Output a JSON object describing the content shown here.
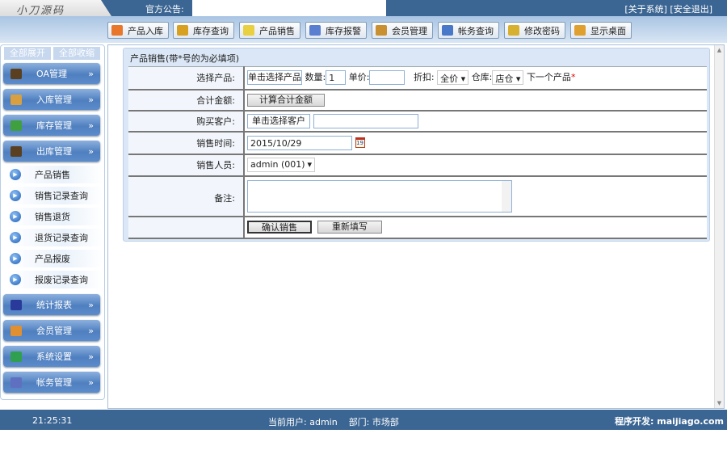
{
  "header": {
    "logo": "小刀源码",
    "notice_label": "官方公告:",
    "links": [
      "[关于系统]",
      "[安全退出]"
    ]
  },
  "toolbar": [
    {
      "label": "产品入库",
      "icon": "house-icon",
      "color": "#e8762b"
    },
    {
      "label": "库存查询",
      "icon": "book-icon",
      "color": "#d8a020"
    },
    {
      "label": "产品销售",
      "icon": "tag-icon",
      "color": "#e8d040"
    },
    {
      "label": "库存报警",
      "icon": "speaker-icon",
      "color": "#5a7fd0"
    },
    {
      "label": "会员管理",
      "icon": "member-card-icon",
      "color": "#c89030"
    },
    {
      "label": "帐务查询",
      "icon": "bottle-icon",
      "color": "#4a78c8"
    },
    {
      "label": "修改密码",
      "icon": "key-icon",
      "color": "#d8b030"
    },
    {
      "label": "显示桌面",
      "icon": "desktop-icon",
      "color": "#e0a030"
    }
  ],
  "sidebar": {
    "expand_all": "全部展开",
    "collapse_all": "全部收缩",
    "menus": [
      {
        "label": "OA管理",
        "icon": "oa-icon",
        "color": "#5a4020"
      },
      {
        "label": "入库管理",
        "icon": "stock-in-icon",
        "color": "#d8a040"
      },
      {
        "label": "库存管理",
        "icon": "inventory-icon",
        "color": "#40a040"
      },
      {
        "label": "出库管理",
        "icon": "stock-out-icon",
        "color": "#5a4020"
      }
    ],
    "submenu": [
      "产品销售",
      "销售记录查询",
      "销售退货",
      "退货记录查询",
      "产品报废",
      "报废记录查询"
    ],
    "menus2": [
      {
        "label": "统计报表",
        "icon": "report-icon",
        "color": "#2a3a9a"
      },
      {
        "label": "会员管理",
        "icon": "member-icon",
        "color": "#e09030"
      },
      {
        "label": "系统设置",
        "icon": "globe-icon",
        "color": "#30a050"
      },
      {
        "label": "帐务管理",
        "icon": "accounts-icon",
        "color": "#6070c0"
      }
    ],
    "chevron": "»"
  },
  "form": {
    "title": "产品销售(带*号的为必填项)",
    "select_product_label": "选择产品:",
    "select_product_btn": "单击选择产品",
    "qty_label": "数量:",
    "qty_value": "1",
    "price_label": "单价:",
    "price_value": "",
    "discount_label": "折扣:",
    "discount_value": "全价",
    "warehouse_label": "仓库:",
    "warehouse_value": "店仓",
    "next_product": "下一个产品",
    "required_mark": "*",
    "total_label": "合计金额:",
    "total_btn": "计算合计金额",
    "customer_label": "购买客户:",
    "customer_btn": "单击选择客户",
    "customer_value": "",
    "date_label": "销售时间:",
    "date_value": "2015/10/29",
    "calendar_day": "19",
    "seller_label": "销售人员:",
    "seller_value": "admin (001)",
    "remark_label": "备注:",
    "remark_value": "",
    "confirm_btn": "确认销售",
    "reset_btn": "重新填写"
  },
  "footer": {
    "time": "21:25:31",
    "user_label": "当前用户:",
    "user": "admin",
    "dept_label": "部门:",
    "dept": "市场部",
    "dev": "程序开发: maijiago.com"
  }
}
